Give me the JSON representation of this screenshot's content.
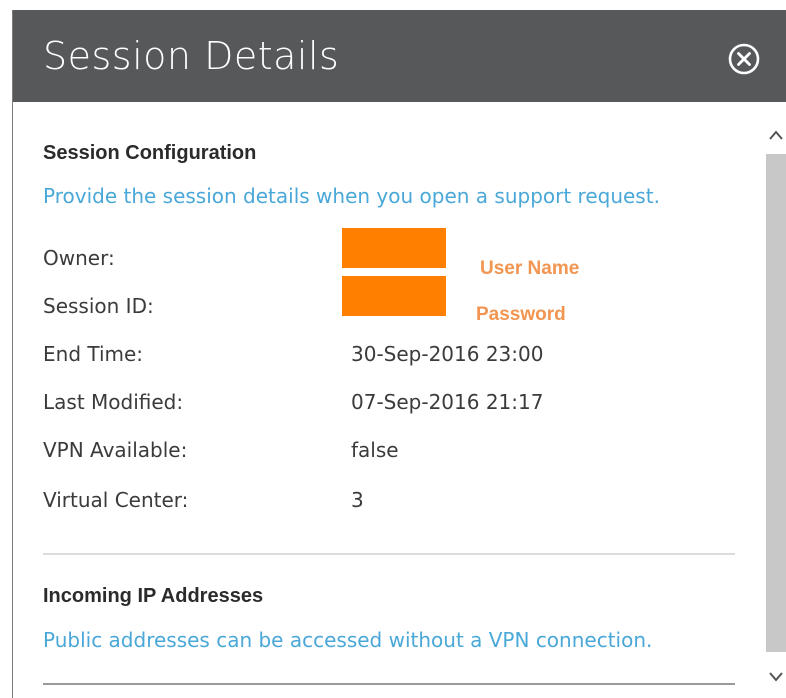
{
  "dialog": {
    "title": "Session Details",
    "close_icon": "close-circle-icon"
  },
  "session_configuration": {
    "heading": "Session Configuration",
    "description": "Provide the session details when you open a support request.",
    "fields": [
      {
        "label": "Owner:",
        "value": "",
        "redacted": true,
        "annotation": "User Name"
      },
      {
        "label": "Session ID:",
        "value": "",
        "redacted": true,
        "annotation": "Password"
      },
      {
        "label": "End Time:",
        "value": "30-Sep-2016 23:00"
      },
      {
        "label": "Last Modified:",
        "value": "07-Sep-2016 21:17"
      },
      {
        "label": "VPN Available:",
        "value": "false"
      },
      {
        "label": "Virtual Center:",
        "value": "3"
      }
    ]
  },
  "incoming_ip": {
    "heading": "Incoming IP Addresses",
    "description": "Public addresses can be accessed without a VPN connection."
  },
  "colors": {
    "header_bg": "#57585a",
    "link_blue": "#4aa8d8",
    "redaction_orange": "#ff7f00",
    "annotation_orange": "#f29551"
  },
  "scrollbar": {
    "up_icon": "chevron-up-icon",
    "down_icon": "chevron-down-icon"
  }
}
